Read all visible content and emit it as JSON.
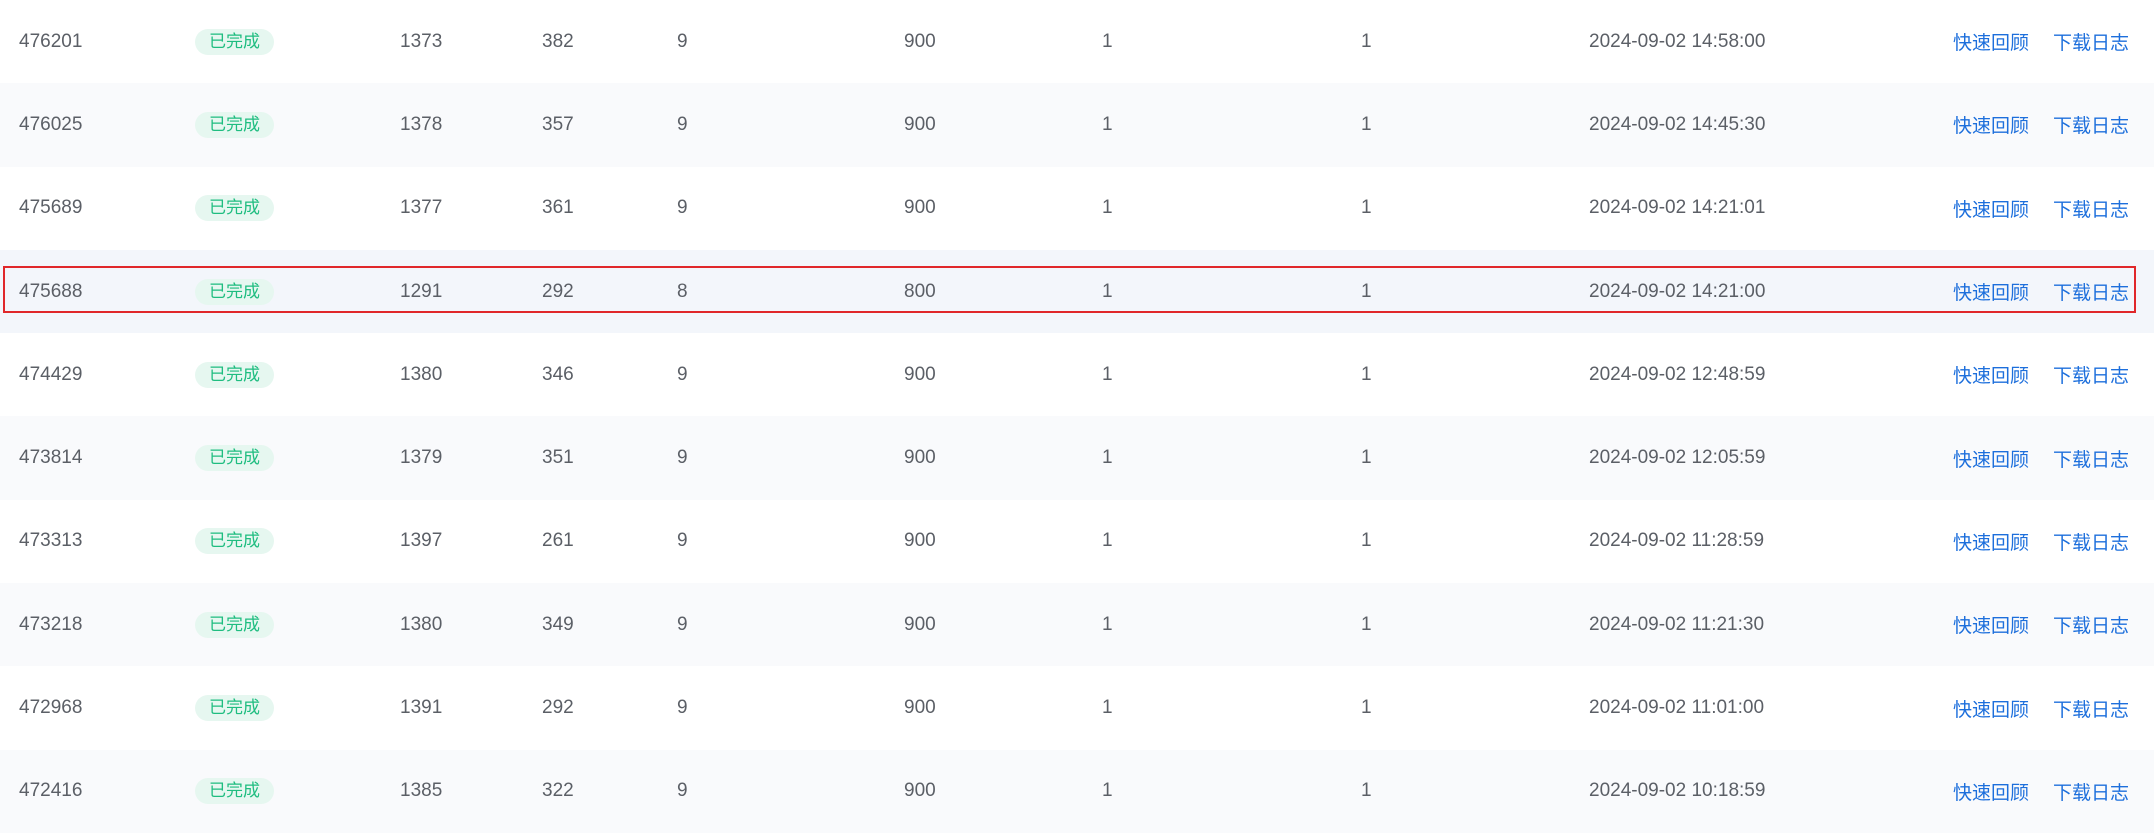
{
  "rows": [
    {
      "id": "476201",
      "status": "已完成",
      "a": "1373",
      "b": "382",
      "c": "9",
      "d": "900",
      "e": "1",
      "f": "1",
      "time": "2024-09-02 14:58:00",
      "action1": "快速回顾",
      "action2": "下载日志"
    },
    {
      "id": "476025",
      "status": "已完成",
      "a": "1378",
      "b": "357",
      "c": "9",
      "d": "900",
      "e": "1",
      "f": "1",
      "time": "2024-09-02 14:45:30",
      "action1": "快速回顾",
      "action2": "下载日志"
    },
    {
      "id": "475689",
      "status": "已完成",
      "a": "1377",
      "b": "361",
      "c": "9",
      "d": "900",
      "e": "1",
      "f": "1",
      "time": "2024-09-02 14:21:01",
      "action1": "快速回顾",
      "action2": "下载日志"
    },
    {
      "id": "475688",
      "status": "已完成",
      "a": "1291",
      "b": "292",
      "c": "8",
      "d": "800",
      "e": "1",
      "f": "1",
      "time": "2024-09-02 14:21:00",
      "action1": "快速回顾",
      "action2": "下载日志"
    },
    {
      "id": "474429",
      "status": "已完成",
      "a": "1380",
      "b": "346",
      "c": "9",
      "d": "900",
      "e": "1",
      "f": "1",
      "time": "2024-09-02 12:48:59",
      "action1": "快速回顾",
      "action2": "下载日志"
    },
    {
      "id": "473814",
      "status": "已完成",
      "a": "1379",
      "b": "351",
      "c": "9",
      "d": "900",
      "e": "1",
      "f": "1",
      "time": "2024-09-02 12:05:59",
      "action1": "快速回顾",
      "action2": "下载日志"
    },
    {
      "id": "473313",
      "status": "已完成",
      "a": "1397",
      "b": "261",
      "c": "9",
      "d": "900",
      "e": "1",
      "f": "1",
      "time": "2024-09-02 11:28:59",
      "action1": "快速回顾",
      "action2": "下载日志"
    },
    {
      "id": "473218",
      "status": "已完成",
      "a": "1380",
      "b": "349",
      "c": "9",
      "d": "900",
      "e": "1",
      "f": "1",
      "time": "2024-09-02 11:21:30",
      "action1": "快速回顾",
      "action2": "下载日志"
    },
    {
      "id": "472968",
      "status": "已完成",
      "a": "1391",
      "b": "292",
      "c": "9",
      "d": "900",
      "e": "1",
      "f": "1",
      "time": "2024-09-02 11:01:00",
      "action1": "快速回顾",
      "action2": "下载日志"
    },
    {
      "id": "472416",
      "status": "已完成",
      "a": "1385",
      "b": "322",
      "c": "9",
      "d": "900",
      "e": "1",
      "f": "1",
      "time": "2024-09-02 10:18:59",
      "action1": "快速回顾",
      "action2": "下载日志"
    }
  ],
  "highlighted_row_id": "475688",
  "colors": {
    "status_text": "#1fbd80",
    "status_bg": "#e6f7f0",
    "link": "#1d6fdc",
    "highlight_border": "#e0272a"
  }
}
